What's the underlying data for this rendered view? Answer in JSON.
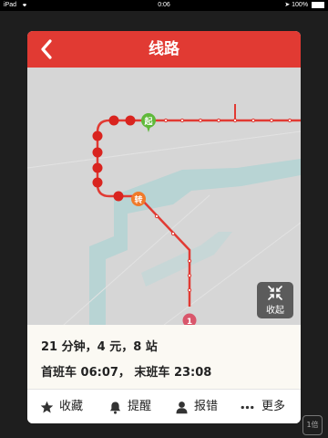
{
  "status_bar": {
    "device": "iPad",
    "time": "0:06",
    "battery": "100%"
  },
  "header": {
    "title": "线路",
    "back_icon": "chevron-left-icon"
  },
  "map": {
    "start_marker": "起",
    "transfer_marker": "转",
    "line_badge": "1",
    "collapse_label": "收起",
    "collapse_icon": "compress-arrows-icon",
    "colors": {
      "route": "#e13a33",
      "start": "#5fb93a",
      "transfer": "#f07a2a",
      "water": "#b6d3d3",
      "map_bg": "#d6d6d6"
    }
  },
  "summary": {
    "line1": "21 分钟，4 元，8 站",
    "line2": "首班车 06:07，  末班车 23:08"
  },
  "actions": [
    {
      "label": "收藏",
      "icon": "star-icon"
    },
    {
      "label": "提醒",
      "icon": "bell-icon"
    },
    {
      "label": "报错",
      "icon": "person-icon"
    },
    {
      "label": "更多",
      "icon": "more-dots-icon"
    }
  ],
  "corner_badge": "1倍"
}
